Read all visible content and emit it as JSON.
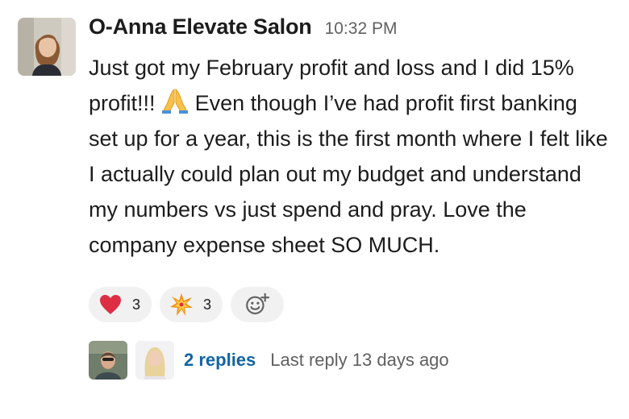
{
  "message": {
    "sender": "O-Anna Elevate Salon",
    "timestamp": "10:32 PM",
    "text_part1": "Just got my February profit and loss and I did 15% profit!!!",
    "emoji_inline": "folded-hands",
    "text_part2": "Even though I’ve had profit first banking set up for a year, this is the first month where I felt like I actually could plan out my budget and understand my numbers vs just spend and pray. Love the company expense sheet SO MUCH."
  },
  "reactions": [
    {
      "emoji": "red-heart",
      "count": "3"
    },
    {
      "emoji": "collision",
      "count": "3"
    }
  ],
  "add_reaction_icon": "add-reaction-icon",
  "thread": {
    "replies_label": "2 replies",
    "last_reply": "Last reply 13 days ago"
  },
  "colors": {
    "link": "#1264a3",
    "muted": "#616061",
    "text": "#1d1c1d",
    "reaction_bg": "#f1f1f1"
  }
}
